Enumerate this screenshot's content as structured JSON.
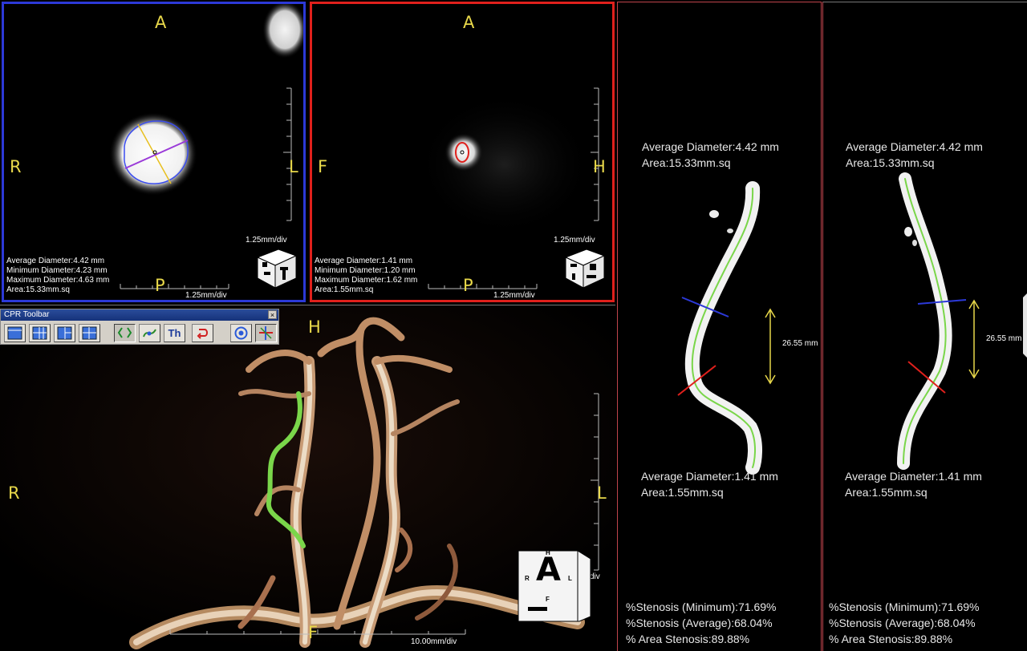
{
  "axial_left": {
    "orient_top": "A",
    "orient_left": "R",
    "orient_right": "L",
    "orient_bottom": "P",
    "scale_vertical": "1.25mm/div",
    "scale_horizontal": "1.25mm/div",
    "measurements": [
      "Average Diameter:4.42 mm",
      "Minimum Diameter:4.23 mm",
      "Maximum Diameter:4.63 mm",
      "Area:15.33mm.sq"
    ],
    "border_color": "#2c39d8"
  },
  "axial_right": {
    "orient_top": "A",
    "orient_left": "F",
    "orient_right": "H",
    "orient_bottom": "P",
    "scale_vertical": "1.25mm/div",
    "scale_horizontal": "1.25mm/div",
    "measurements": [
      "Average Diameter:1.41 mm",
      "Minimum Diameter:1.20 mm",
      "Maximum Diameter:1.62 mm",
      "Area:1.55mm.sq"
    ],
    "border_color": "#e0201c"
  },
  "volume_view": {
    "orient_top": "H",
    "orient_left": "R",
    "orient_right": "L",
    "orient_bottom": "F",
    "scale_horizontal": "10.00mm/div",
    "scale_vertical": "div",
    "cube_face": "A",
    "cube_labels": {
      "top": "H",
      "left": "R",
      "right": "L",
      "bottom": "F"
    }
  },
  "toolbar": {
    "title": "CPR Toolbar",
    "close": "×",
    "th_label": "Th"
  },
  "cpr_left": {
    "proximal": {
      "avg": "Average Diameter:4.42 mm",
      "area": "Area:15.33mm.sq"
    },
    "distal": {
      "avg": "Average Diameter:1.41 mm",
      "area": "Area:1.55mm.sq"
    },
    "length": "26.55 mm",
    "stats": [
      "%Stenosis (Minimum):71.69%",
      "%Stenosis (Average):68.04%",
      "% Area Stenosis:89.88%"
    ]
  },
  "cpr_right": {
    "proximal": {
      "avg": "Average Diameter:4.42 mm",
      "area": "Area:15.33mm.sq"
    },
    "distal": {
      "avg": "Average Diameter:1.41 mm",
      "area": "Area:1.55mm.sq"
    },
    "length": "26.55 mm",
    "stats": [
      "%Stenosis (Minimum):71.69%",
      "%Stenosis (Average):68.04%",
      "% Area Stenosis:89.88%"
    ]
  },
  "colors": {
    "orientation_label": "#e8d84a",
    "centerline": "#7ad64a",
    "distal_marker": "#e0201c",
    "proximal_marker": "#2c39d8",
    "length_marker": "#e8d84a"
  }
}
